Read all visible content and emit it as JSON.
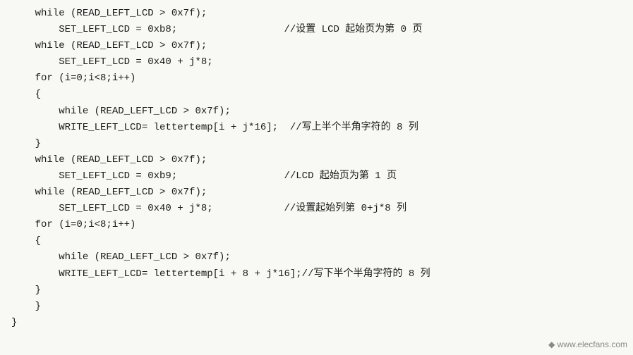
{
  "code": {
    "lines": [
      {
        "indent": 1,
        "code": "while (READ_LEFT_LCD > 0x7f);",
        "comment": ""
      },
      {
        "indent": 2,
        "code": "SET_LEFT_LCD = 0xb8;",
        "comment": "//设置 LCD 起始页为第 0 页"
      },
      {
        "indent": 1,
        "code": "while (READ_LEFT_LCD > 0x7f);",
        "comment": ""
      },
      {
        "indent": 2,
        "code": "SET_LEFT_LCD = 0x40 + j*8;",
        "comment": ""
      },
      {
        "indent": 1,
        "code": "for (i=0;i<8;i++)",
        "comment": ""
      },
      {
        "indent": 1,
        "code": "{",
        "comment": ""
      },
      {
        "indent": 2,
        "code": "while (READ_LEFT_LCD > 0x7f);",
        "comment": ""
      },
      {
        "indent": 2,
        "code": "WRITE_LEFT_LCD= lettertemp[i + j*16];",
        "comment": "//写上半个半角字符的 8 列"
      },
      {
        "indent": 1,
        "code": "}",
        "comment": ""
      },
      {
        "indent": 1,
        "code": "while (READ_LEFT_LCD > 0x7f);",
        "comment": ""
      },
      {
        "indent": 2,
        "code": "SET_LEFT_LCD = 0xb9;",
        "comment": "//LCD 起始页为第 1 页"
      },
      {
        "indent": 1,
        "code": "while (READ_LEFT_LCD > 0x7f);",
        "comment": ""
      },
      {
        "indent": 2,
        "code": "SET_LEFT_LCD = 0x40 + j*8;",
        "comment": "//设置起始列第 0+j*8 列"
      },
      {
        "indent": 1,
        "code": "for (i=0;i<8;i++)",
        "comment": ""
      },
      {
        "indent": 1,
        "code": "{",
        "comment": ""
      },
      {
        "indent": 2,
        "code": "while (READ_LEFT_LCD > 0x7f);",
        "comment": ""
      },
      {
        "indent": 2,
        "code": "WRITE_LEFT_LCD= lettertemp[i + 8 + j*16];//写下半个半角字符的 8 列",
        "comment": ""
      },
      {
        "indent": 1,
        "code": "}",
        "comment": ""
      },
      {
        "indent": 1,
        "code": "}",
        "comment": ""
      },
      {
        "indent": 0,
        "code": "}",
        "comment": ""
      }
    ]
  },
  "watermark": "◆ www.elecfans.com"
}
